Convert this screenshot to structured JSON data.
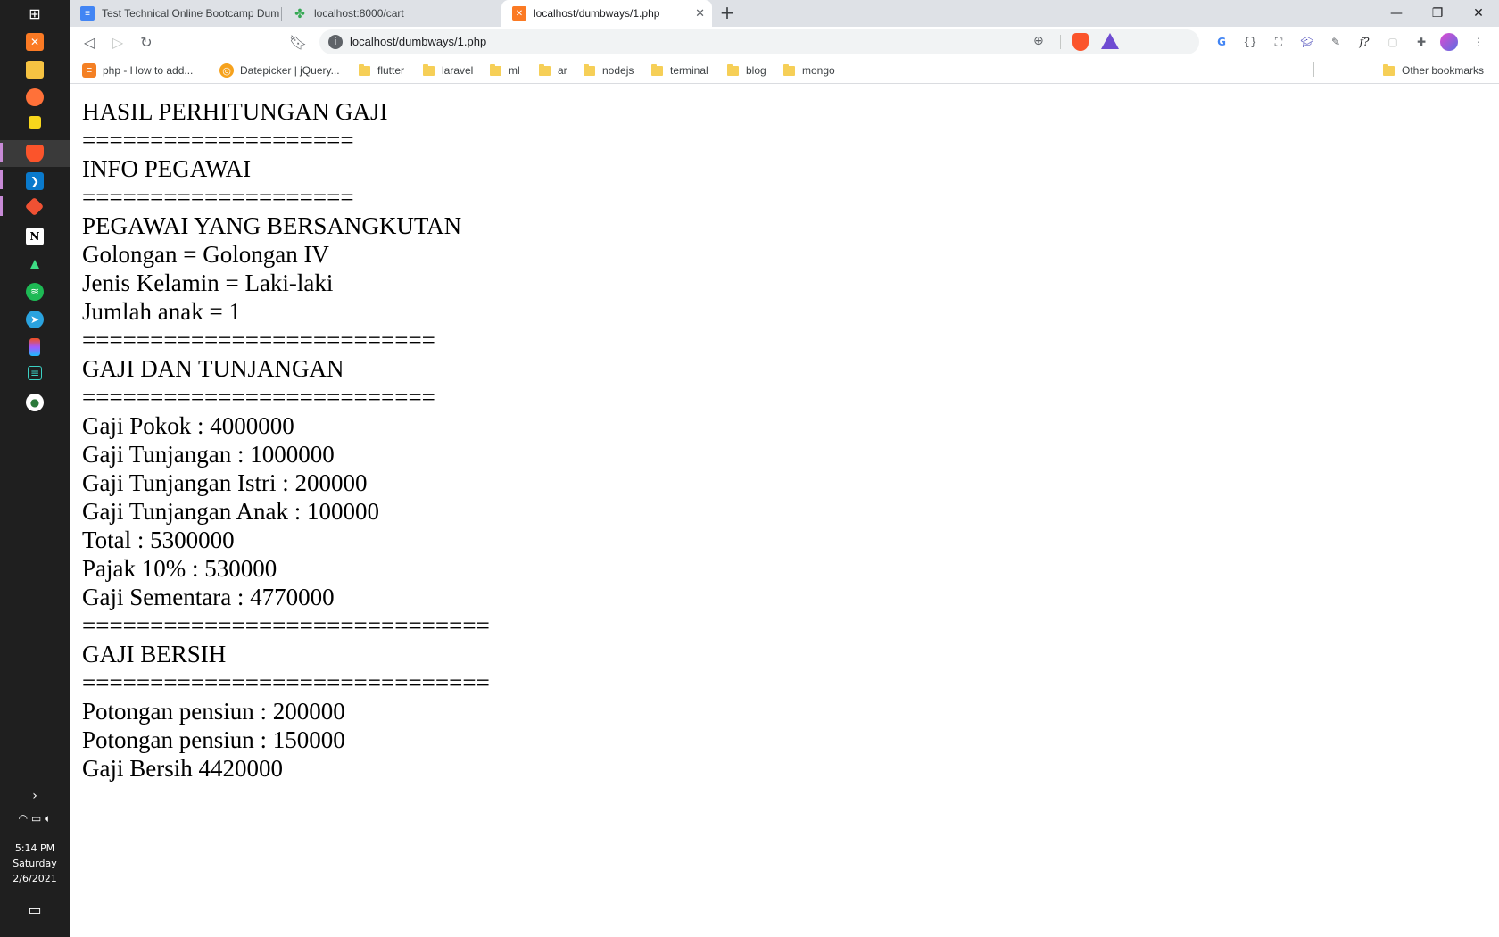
{
  "taskbar": {
    "icons": [
      "windows-start-icon",
      "xampp-icon",
      "file-explorer-icon",
      "firefox-icon",
      "sticky-notes-icon",
      "brave-icon",
      "vscode-icon",
      "git-icon",
      "notion-icon",
      "android-studio-icon",
      "spotify-icon",
      "telegram-icon",
      "figma-icon",
      "terminal-icon",
      "app-icon"
    ],
    "tray": {
      "time": "5:14 PM",
      "day": "Saturday",
      "date": "2/6/2021"
    }
  },
  "tabs": [
    {
      "title": "Test Technical Online Bootcamp Dumb",
      "icon": "docs-icon",
      "color": "#4285f4"
    },
    {
      "title": "localhost:8000/cart",
      "icon": "leaf-icon",
      "color": "#34a853"
    },
    {
      "title": "localhost/dumbways/1.php",
      "icon": "xampp-icon",
      "color": "#fb7a24",
      "active": true,
      "close": "✕"
    }
  ],
  "window_controls": {
    "minimize": "—",
    "restore": "❐",
    "close": "✕"
  },
  "toolbar": {
    "url": "localhost/dumbways/1.php",
    "info_glyph": "i"
  },
  "extensions": [
    "translate-icon",
    "json-icon",
    "screenshot-icon",
    "graduation-icon",
    "eyedropper-icon",
    "font-icon",
    "extension-icon",
    "puzzle-icon",
    "profile-avatar",
    "menu-icon"
  ],
  "bookmarks": [
    {
      "label": "php - How to add...",
      "type": "site",
      "icon_color": "#f48024"
    },
    {
      "label": "Datepicker | jQuery...",
      "type": "site",
      "icon_color": "#f6a21d"
    },
    {
      "label": "flutter",
      "type": "folder"
    },
    {
      "label": "laravel",
      "type": "folder"
    },
    {
      "label": "ml",
      "type": "folder"
    },
    {
      "label": "ar",
      "type": "folder"
    },
    {
      "label": "nodejs",
      "type": "folder"
    },
    {
      "label": "terminal",
      "type": "folder"
    },
    {
      "label": "blog",
      "type": "folder"
    },
    {
      "label": "mongo",
      "type": "folder"
    }
  ],
  "other_bookmarks": "Other bookmarks",
  "content": {
    "lines": [
      "HASIL PERHITUNGAN GAJI",
      "====================",
      "INFO PEGAWAI",
      "====================",
      "PEGAWAI YANG BERSANGKUTAN",
      "Golongan = Golongan IV",
      "Jenis Kelamin = Laki-laki",
      "Jumlah anak = 1",
      "==========================",
      "GAJI DAN TUNJANGAN",
      "==========================",
      "Gaji Pokok : 4000000",
      "Gaji Tunjangan : 1000000",
      "Gaji Tunjangan Istri : 200000",
      "Gaji Tunjangan Anak : 100000",
      "Total : 5300000",
      "Pajak 10% : 530000",
      "Gaji Sementara : 4770000",
      "==============================",
      "GAJI BERSIH",
      "==============================",
      "Potongan pensiun : 200000",
      "Potongan pensiun : 150000",
      "Gaji Bersih 4420000"
    ]
  }
}
